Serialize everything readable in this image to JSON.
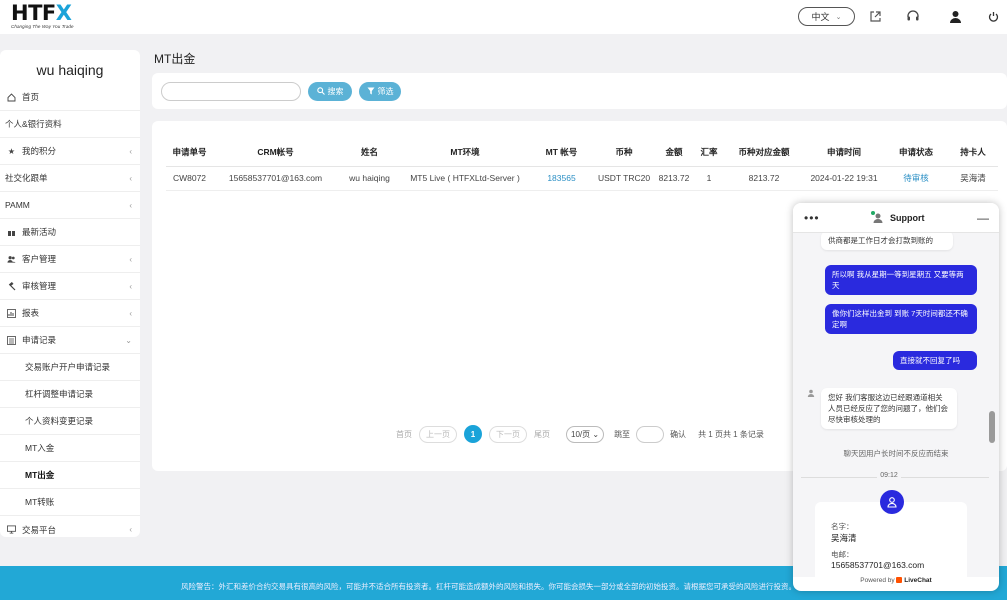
{
  "header": {
    "logo_text": "HTFX",
    "logo_tagline": "Changing The Way You Trade",
    "language": "中文"
  },
  "sidebar": {
    "username": "wu haiqing",
    "items": [
      {
        "label": "首页",
        "icon": "home-icon"
      },
      {
        "label": "个人&银行资料"
      },
      {
        "label": "我的积分",
        "icon": "star-icon",
        "caret": "‹"
      },
      {
        "label": "社交化跟单",
        "caret": "‹"
      },
      {
        "label": "PAMM",
        "caret": "‹"
      },
      {
        "label": "最新活动",
        "icon": "gift-icon"
      },
      {
        "label": "客户管理",
        "icon": "users-icon",
        "caret": "‹"
      },
      {
        "label": "审核管理",
        "icon": "gavel-icon",
        "caret": "‹"
      },
      {
        "label": "报表",
        "icon": "chart-icon",
        "caret": "‹"
      },
      {
        "label": "申请记录",
        "icon": "list-icon",
        "caret": "⌄"
      },
      {
        "label": "交易账户开户申请记录"
      },
      {
        "label": "杠杆调整申请记录"
      },
      {
        "label": "个人资料变更记录"
      },
      {
        "label": "MT入金"
      },
      {
        "label": "MT出金"
      },
      {
        "label": "MT转账"
      },
      {
        "label": "交易平台",
        "icon": "monitor-icon",
        "caret": "‹"
      }
    ]
  },
  "main": {
    "title": "MT出金",
    "search_button": "搜索",
    "filter_button": "筛选",
    "table": {
      "headers": [
        "申请单号",
        "CRM帐号",
        "姓名",
        "MT环境",
        "MT 帐号",
        "币种",
        "金额",
        "汇率",
        "币种对应金额",
        "申请时间",
        "申请状态",
        "持卡人"
      ],
      "rows": [
        [
          "CW8072",
          "15658537701@163.com",
          "wu haiqing",
          "MT5 Live ( HTFXLtd-Server )",
          "183565",
          "USDT TRC20",
          "8213.72",
          "1",
          "8213.72",
          "2024-01-22 19:31",
          "待审核",
          "吴海清"
        ]
      ]
    },
    "pagination": {
      "first": "首页",
      "prev": "上一页",
      "current": "1",
      "next": "下一页",
      "last": "尾页",
      "page_size": "10/页",
      "goto_label": "跳至",
      "confirm": "确认",
      "summary": "共 1 页共 1 条记录"
    }
  },
  "footer": {
    "risk_warning": "风险警告：外汇和差价合约交易具有很高的风险，可能并不适合所有投资者。杠杆可能造成额外的风险和损失。你可能会损失一部分或全部的初始投资。请根据您可承受的风险进行投资。在"
  },
  "chat": {
    "title": "Support",
    "messages": [
      {
        "from": "agent",
        "text": "供商都是工作日才会打款到账的"
      },
      {
        "from": "user",
        "text": "所以啊 我从星期一等到星期五 又要等两天"
      },
      {
        "from": "user",
        "text": "像你们这样出金到 到账 7天时间都还不确定啊"
      },
      {
        "from": "user",
        "text": "直接就不回复了吗"
      },
      {
        "from": "agent",
        "text": "您好 我们客服这边已经跟通道相关人员已经反应了您的问题了，他们会尽快审核处理的"
      }
    ],
    "system_note": "聊天因用户长时间不反应而结束",
    "time_divider": "09:12",
    "form": {
      "name_label": "名字：",
      "name_value": "吴海清",
      "email_label": "电邮：",
      "email_value": "15658537701@163.com"
    },
    "powered_by": "Powered by",
    "brand": "LiveChat"
  },
  "colors": {
    "accent": "#1aa3d9",
    "button": "#5bb2d6",
    "chat_user": "#2a2ade",
    "footer": "#22a8d6"
  }
}
